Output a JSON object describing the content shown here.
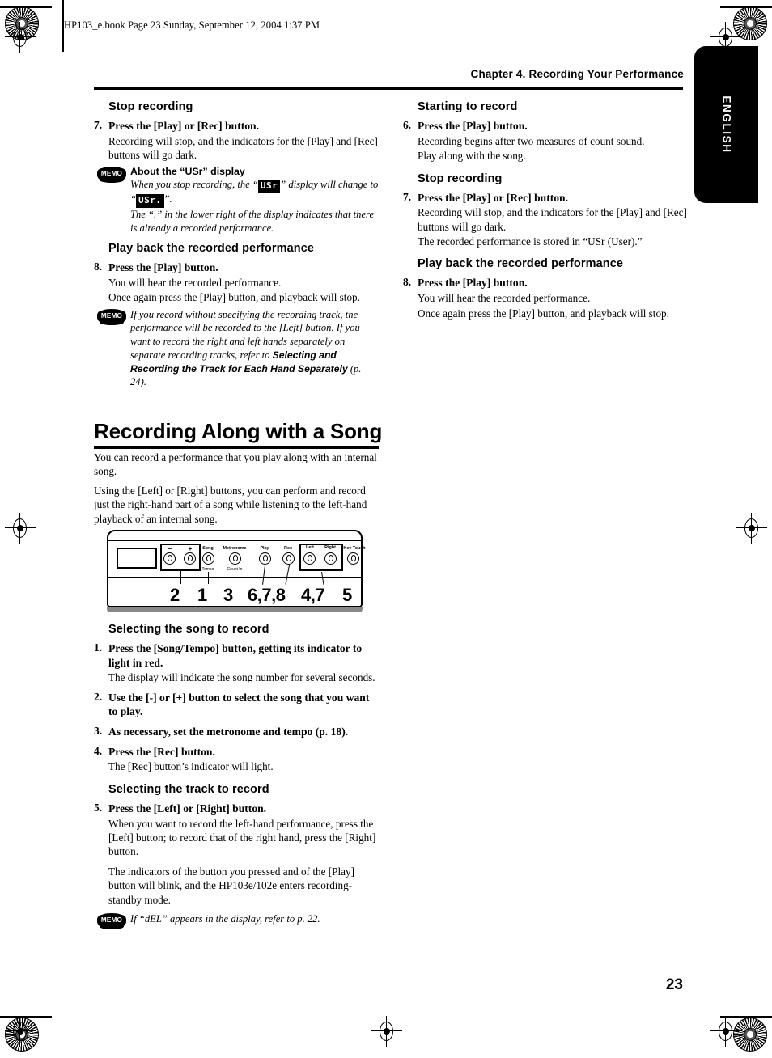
{
  "print": {
    "file_header": "HP103_e.book  Page 23  Sunday, September 12, 2004  1:37 PM",
    "page_number": "23"
  },
  "header": {
    "chapter": "Chapter 4. Recording Your Performance",
    "side_tab": "ENGLISH"
  },
  "left_column": {
    "section1": {
      "heading": "Stop recording",
      "step_num": "7.",
      "step_title": "Press the [Play] or [Rec] button.",
      "body": "Recording will stop, and the indicators for the [Play] and [Rec] buttons will go dark.",
      "memo": {
        "icon": "MEMO",
        "heading": "About the “USr” display",
        "line1_a": "When you stop recording, the “",
        "led1": "USr",
        "line1_b": "” display will change to “",
        "led2": "USr.",
        "line1_c": "”.",
        "line2": "The “.” in the lower right of the display indicates that there is already a recorded performance."
      }
    },
    "section2": {
      "heading": "Play back the recorded performance",
      "step_num": "8.",
      "step_title": "Press the [Play] button.",
      "body1": "You will hear the recorded performance.",
      "body2": "Once again press the [Play] button, and playback will stop.",
      "memo": {
        "icon": "MEMO",
        "text_a": "If you record without specifying the recording track, the performance will be recorded to the [Left] button. If you want to record the right and left hands separately on separate recording tracks, refer to ",
        "ref": "Selecting and Recording the Track for Each Hand Separately",
        "text_b": " (p. 24)."
      }
    }
  },
  "right_column": {
    "section1": {
      "heading": "Starting to record",
      "step_num": "6.",
      "step_title": "Press the [Play] button.",
      "body1": "Recording begins after two measures of count sound.",
      "body2": "Play along with the song."
    },
    "section2": {
      "heading": "Stop recording",
      "step_num": "7.",
      "step_title": "Press the [Play] or [Rec] button.",
      "body1": "Recording will stop, and the indicators for the [Play] and [Rec] buttons will go dark.",
      "body2": "The recorded performance is stored in “USr (User).”"
    },
    "section3": {
      "heading": "Play back the recorded performance",
      "step_num": "8.",
      "step_title": "Press the [Play] button.",
      "body1": "You will hear the recorded performance.",
      "body2": "Once again press the [Play] button, and playback will stop."
    }
  },
  "main_section": {
    "title": "Recording Along with a Song",
    "intro1": "You can record a performance that you play along with an internal song.",
    "intro2": "Using the [Left] or [Right] buttons, you can perform and record just the right-hand part of a song while listening to the left-hand playback of an internal song."
  },
  "panel_diagram": {
    "buttons": [
      {
        "label": "–",
        "sub": ""
      },
      {
        "label": "+",
        "sub": ""
      },
      {
        "label": "Song",
        "sub": "Tempo"
      },
      {
        "label": "Metronome",
        "sub": "Count In"
      },
      {
        "label": "Play",
        "sub": ""
      },
      {
        "label": "Rec",
        "sub": ""
      },
      {
        "label": "Left",
        "sub": ""
      },
      {
        "label": "Right",
        "sub": ""
      },
      {
        "label": "Key Touch",
        "sub": ""
      }
    ],
    "callouts": [
      "2",
      "1",
      "3",
      "6,7,8",
      "4,7",
      "5"
    ]
  },
  "procedure": {
    "section1_heading": "Selecting the song to record",
    "steps": [
      {
        "num": "1.",
        "title": "Press the [Song/Tempo] button, getting its indicator to light in red.",
        "body": "The display will indicate the song number for several seconds."
      },
      {
        "num": "2.",
        "title": "Use the [-] or [+] button to select the song that you want to play.",
        "body": ""
      },
      {
        "num": "3.",
        "title": "As necessary, set the metronome and tempo (p. 18).",
        "body": ""
      },
      {
        "num": "4.",
        "title": "Press the [Rec] button.",
        "body": "The [Rec] button’s indicator will light."
      }
    ],
    "section2_heading": "Selecting the track to record",
    "step5": {
      "num": "5.",
      "title": "Press the [Left] or [Right] button.",
      "body1": "When you want to record the left-hand performance, press the [Left] button; to record that of the right hand, press the [Right] button.",
      "body2": "The indicators of the button you pressed and of the [Play] button will blink, and the HP103e/102e enters recording-standby mode.",
      "memo": {
        "icon": "MEMO",
        "text": "If “dEL” appears in the display, refer to p. 22."
      }
    }
  }
}
